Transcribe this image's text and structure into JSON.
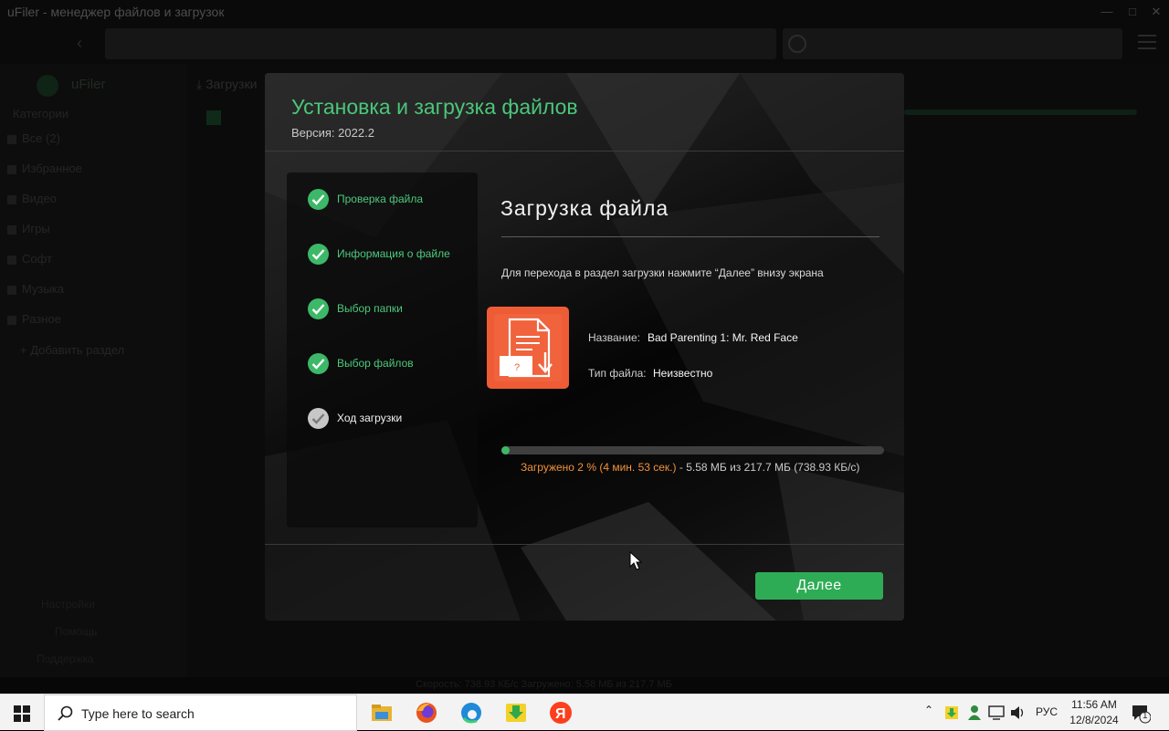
{
  "app": {
    "title": "uFiler - менеджер файлов и загрузок",
    "sidebar_heading": "Категории",
    "sidebar_items": [
      "Все (2)",
      "Избранное",
      "Видео",
      "Игры",
      "Софт",
      "Музыка",
      "Разное"
    ],
    "sidebar_add": "+ Добавить раздел",
    "sidebar_bottom": [
      "Настройки",
      "Помощь",
      "Поддержка"
    ],
    "content_header": "Загрузки",
    "status_text": "Скорость: 738.93 КБ/с  Загружено: 5.58 МБ из 217.7 МБ"
  },
  "dialog": {
    "title": "Установка и загрузка файлов",
    "version": "Версия: 2022.2",
    "steps": [
      {
        "label": "Проверка файла",
        "done": true
      },
      {
        "label": "Информация о файле",
        "done": true
      },
      {
        "label": "Выбор папки",
        "done": true
      },
      {
        "label": "Выбор файлов",
        "done": true
      },
      {
        "label": "Ход загрузки",
        "done": false
      }
    ],
    "main_title": "Загрузка файла",
    "hint": "Для перехода в раздел загрузки нажмите “Далее” внизу экрана",
    "file": {
      "name_label": "Название:",
      "name_value": "Bad Parenting 1: Mr. Red Face",
      "type_label": "Тип файла:",
      "type_value": "Неизвестно",
      "icon": "unknown-file-download-icon"
    },
    "progress": {
      "fraction": 0.02,
      "status": "Загружено 2 % (4 мин. 53 сек.)",
      "separator": " - ",
      "size": "5.58 МБ  из  217.7 МБ  (738.93 КБ/с)"
    },
    "next_label": "Далее"
  },
  "taskbar": {
    "search_placeholder": "Type here to search",
    "apps": [
      "file-explorer-icon",
      "firefox-icon",
      "edge-icon",
      "download-manager-icon",
      "yandex-icon"
    ],
    "language": "РУС",
    "time": "11:56 AM",
    "date": "12/8/2024",
    "notification_count": "1"
  },
  "colors": {
    "accent_green": "#3cb868",
    "title_green": "#4bc67a",
    "progress_orange": "#f0923c",
    "file_icon_orange": "#ee5c36"
  }
}
